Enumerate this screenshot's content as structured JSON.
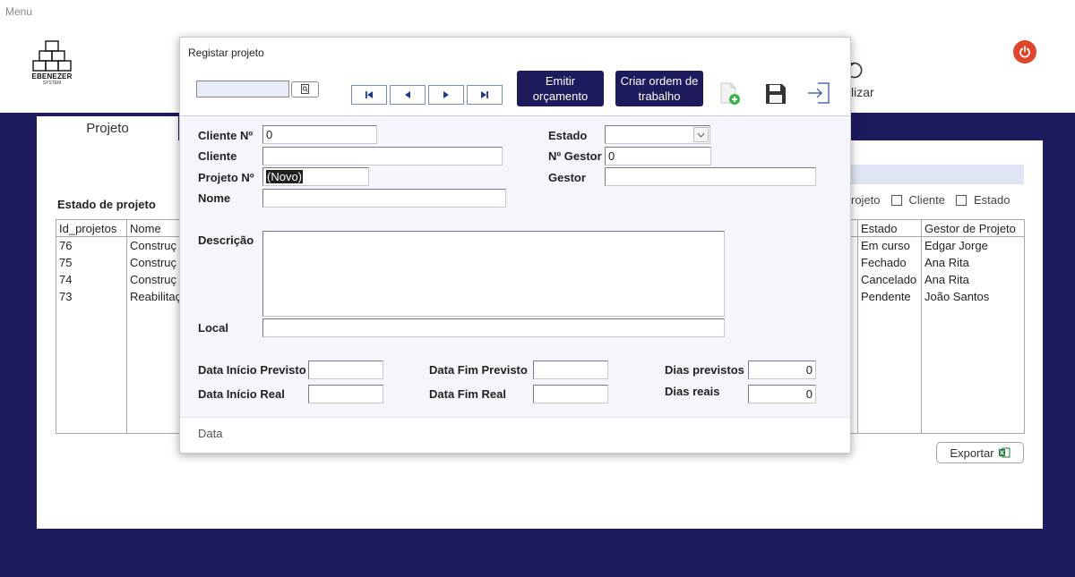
{
  "app": {
    "menu_label": "Menu",
    "logo": {
      "brand": "EBENEZER",
      "sub": "SYSTEM"
    },
    "refresh_label": "lizar",
    "tab_label": "Projeto",
    "section_title": "Estado de projeto",
    "filters": {
      "partial_label": "rojeto",
      "cliente_label": "Cliente",
      "estado_label": "Estado"
    },
    "table": {
      "headers": {
        "id": "Id_projetos",
        "nome": "Nome",
        "estado": "Estado",
        "gestor": "Gestor de Projeto"
      },
      "rows": [
        {
          "id": "76",
          "nome": "Construç",
          "estado": "Em curso",
          "gestor": "Edgar Jorge"
        },
        {
          "id": "75",
          "nome": "Construç",
          "estado": "Fechado",
          "gestor": "Ana Rita"
        },
        {
          "id": "74",
          "nome": "Construç",
          "estado": "Cancelado",
          "gestor": "Ana Rita"
        },
        {
          "id": "73",
          "nome": "Reabilitaç",
          "estado": "Pendente",
          "gestor": "João Santos"
        }
      ]
    },
    "export_label": "Exportar",
    "colors": {
      "navy": "#1d1a5e",
      "power": "#e0452c",
      "add_green": "#3cb54a"
    }
  },
  "modal": {
    "title": "Registar projeto",
    "search": {
      "value": ""
    },
    "buttons": {
      "emitir": [
        "Emitir",
        "orçamento"
      ],
      "criar": [
        "Criar ordem de",
        "trabalho"
      ]
    },
    "icons": {
      "add": "new-document-icon",
      "save": "save-icon",
      "exit": "exit-icon"
    },
    "fields": {
      "cliente_no": {
        "label": "Cliente Nº",
        "value": "0"
      },
      "cliente": {
        "label": "Cliente",
        "value": ""
      },
      "projeto_no": {
        "label": "Projeto Nº",
        "value": "(Novo)"
      },
      "nome": {
        "label": "Nome",
        "value": ""
      },
      "estado": {
        "label": "Estado",
        "value": ""
      },
      "gestor_no": {
        "label": "Nº Gestor",
        "value": "0"
      },
      "gestor": {
        "label": "Gestor",
        "value": ""
      },
      "descricao": {
        "label": "Descrição",
        "value": ""
      },
      "local": {
        "label": "Local",
        "value": ""
      },
      "data_inicio_previsto": {
        "label": "Data Início Previsto",
        "value": ""
      },
      "data_inicio_real": {
        "label": "Data Início Real",
        "value": ""
      },
      "data_fim_previsto": {
        "label": "Data Fim Previsto",
        "value": ""
      },
      "data_fim_real": {
        "label": "Data Fim Real",
        "value": ""
      },
      "dias_previstos": {
        "label": "Dias previstos",
        "value": "0"
      },
      "dias_reais": {
        "label": "Dias reais",
        "value": "0"
      }
    },
    "footer_label": "Data"
  }
}
